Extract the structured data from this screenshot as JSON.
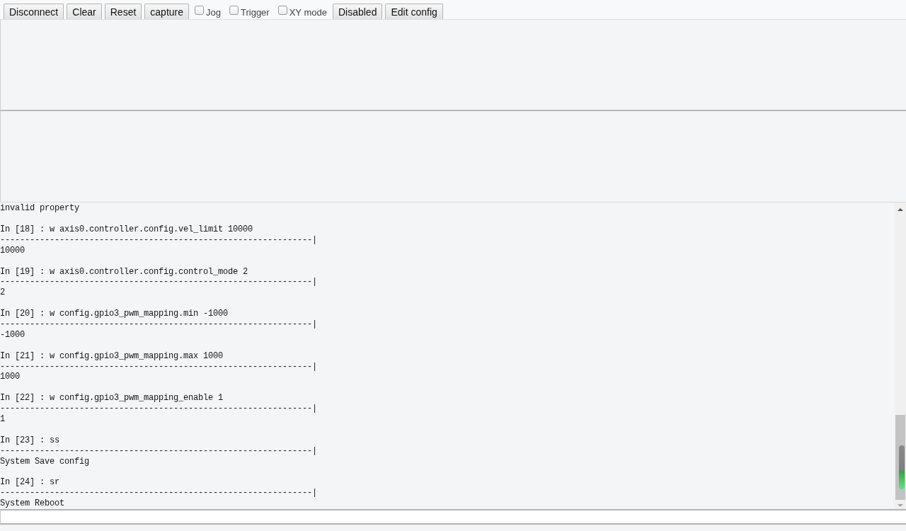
{
  "toolbar": [
    {
      "kind": "button",
      "label": "Disconnect"
    },
    {
      "kind": "button",
      "label": "Clear"
    },
    {
      "kind": "button",
      "label": "Reset"
    },
    {
      "kind": "button",
      "label": "capture"
    },
    {
      "kind": "checkbox",
      "label": "Jog",
      "checked": false
    },
    {
      "kind": "checkbox",
      "label": "Trigger",
      "checked": false
    },
    {
      "kind": "checkbox",
      "label": "XY mode",
      "checked": false
    },
    {
      "kind": "button",
      "label": "Disabled"
    },
    {
      "kind": "button",
      "label": "Edit config"
    }
  ],
  "console": {
    "first_line": "invalid property",
    "entries": [
      {
        "command": "In [18] : w axis0.controller.config.vel_limit 10000",
        "separator": "---------------------------------------------------------------|",
        "output": "10000"
      },
      {
        "command": "In [19] : w axis0.controller.config.control_mode 2",
        "separator": "---------------------------------------------------------------|",
        "output": "2"
      },
      {
        "command": "In [20] : w config.gpio3_pwm_mapping.min -1000",
        "separator": "---------------------------------------------------------------|",
        "output": "-1000"
      },
      {
        "command": "In [21] : w config.gpio3_pwm_mapping.max 1000",
        "separator": "---------------------------------------------------------------|",
        "output": "1000"
      },
      {
        "command": "In [22] : w config.gpio3_pwm_mapping_enable 1",
        "separator": "---------------------------------------------------------------|",
        "output": "1"
      },
      {
        "command": "In [23] : ss",
        "separator": "---------------------------------------------------------------|",
        "output": "System Save config"
      },
      {
        "command": "In [24] : sr",
        "separator": "---------------------------------------------------------------|",
        "output": "System Reboot"
      }
    ]
  }
}
